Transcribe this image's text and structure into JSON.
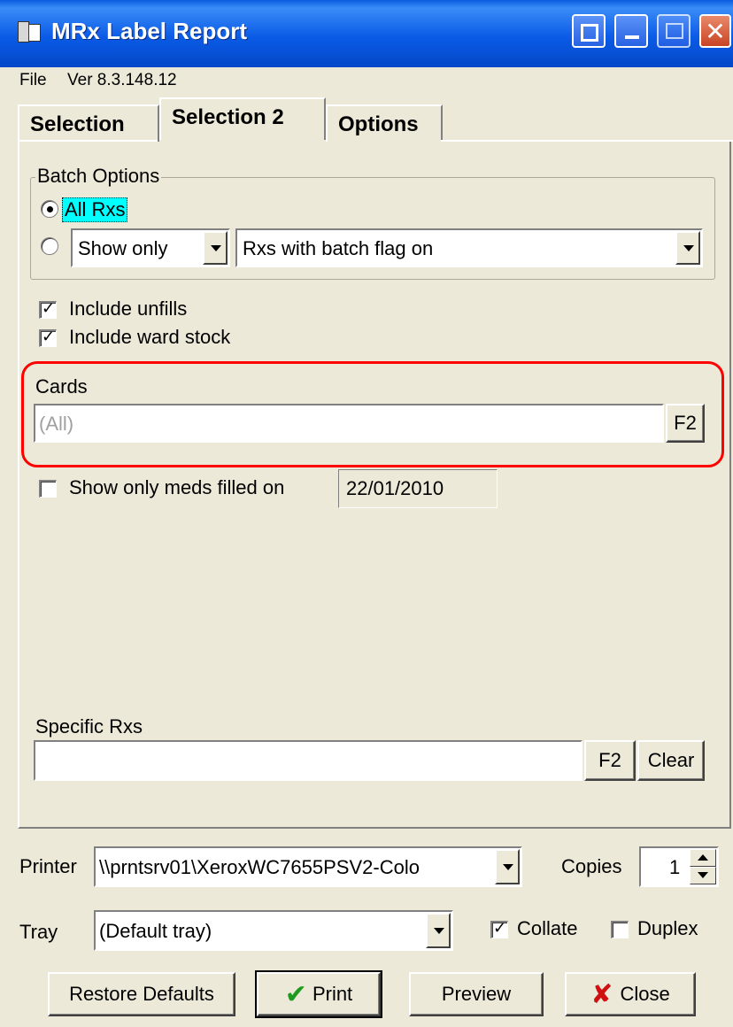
{
  "window": {
    "title": "MRx Label Report"
  },
  "menu": {
    "file": "File",
    "version": "Ver 8.3.148.12"
  },
  "tabs": [
    {
      "label": "Selection"
    },
    {
      "label": "Selection 2"
    },
    {
      "label": "Options"
    }
  ],
  "batch_options": {
    "legend": "Batch Options",
    "all_rxs_label": "All Rxs",
    "all_rxs_selected": true,
    "show_mode_value": "Show only",
    "batch_flag_value": "Rxs with batch flag on"
  },
  "checks": {
    "include_unfills": {
      "label": "Include unfills",
      "checked": true
    },
    "include_ward_stock": {
      "label": "Include ward stock",
      "checked": true
    }
  },
  "cards": {
    "label": "Cards",
    "placeholder": "(All)",
    "f2_label": "F2"
  },
  "filled_on": {
    "label": "Show only meds filled on",
    "checked": false,
    "date": "22/01/2010"
  },
  "specific_rxs": {
    "label": "Specific Rxs",
    "value": "",
    "f2_label": "F2",
    "clear_label": "Clear"
  },
  "printer": {
    "label": "Printer",
    "value": "\\\\prntsrv01\\XeroxWC7655PSV2-Colo",
    "copies_label": "Copies",
    "copies_value": "1"
  },
  "tray": {
    "label": "Tray",
    "value": "(Default tray)",
    "collate_label": "Collate",
    "collate_checked": true,
    "duplex_label": "Duplex",
    "duplex_checked": false
  },
  "buttons": {
    "restore_defaults": "Restore Defaults",
    "print": "Print",
    "preview": "Preview",
    "close": "Close"
  },
  "colors": {
    "titlebar": "#0A5BE0",
    "highlight": "#00FFFF",
    "annotation": "#FF0000",
    "print_check": "#1E9A1E",
    "close_x": "#D01010"
  }
}
